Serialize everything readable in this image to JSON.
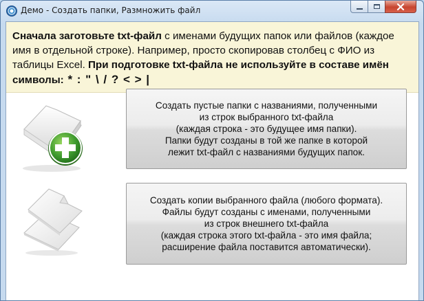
{
  "window": {
    "title": "Демо - Создать папки, Размножить файл"
  },
  "notice": {
    "bold_lead": "Сначала заготовьте txt-файл",
    "normal_text": " с именами будущих папок или файлов (каждое имя в отдельной строке). Например, просто скопировав столбец с ФИО из таблицы Excel. ",
    "bold_warning": "При подготовке txt-файла не используйте в составе имён символы:",
    "forbidden_chars": " * : \" \\ / ? < > |"
  },
  "actions": {
    "create_folders": {
      "icon": "folder-add-icon",
      "label": "Создать пустые папки с названиями, полученными\nиз строк выбранного txt-файла\n(каждая строка - это будущее имя папки).\nПапки будут созданы в той же папке в которой\nлежит txt-файл с названиями будущих папок."
    },
    "copy_file": {
      "icon": "file-copies-icon",
      "label": "Создать копии выбранного файла (любого формата).\nФайлы будут созданы с именами, полученными\nиз строк внешнего txt-файла\n(каждая строка этого txt-файла - это имя файла;\nрасширение файла поставится автоматически)."
    }
  },
  "colors": {
    "notice_bg": "#f9f5d8",
    "title_bg": "#c6daef",
    "close_button": "#c7452f",
    "add_badge": "#3f9b2f"
  }
}
